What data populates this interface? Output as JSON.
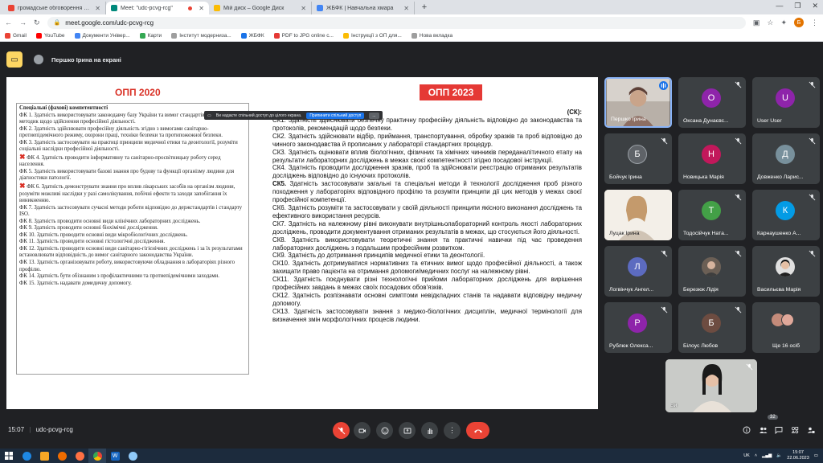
{
  "browser": {
    "tabs": [
      {
        "label": "громадське обговорення ОПП",
        "icon": "gmail-icon",
        "color": "#ea4335",
        "active": false
      },
      {
        "label": "Meet: \"udc-pcvg-rcg\"",
        "icon": "meet-icon",
        "color": "#00897b",
        "active": true
      },
      {
        "label": "Мій диск – Google Диск",
        "icon": "drive-icon",
        "color": "#fbbc04",
        "active": false
      },
      {
        "label": "ЖБФК | Навчальна хмара",
        "icon": "cloud-icon",
        "color": "#4285f4",
        "active": false
      }
    ],
    "url": "meet.google.com/udc-pcvg-rcg",
    "profile_initial": "Б",
    "bookmarks": [
      {
        "label": "Gmail",
        "color": "#ea4335"
      },
      {
        "label": "YouTube",
        "color": "#ff0000"
      },
      {
        "label": "Документи Універ...",
        "color": "#4285f4"
      },
      {
        "label": "Карти",
        "color": "#34a853"
      },
      {
        "label": "Інститут модерниза...",
        "color": "#9e9e9e"
      },
      {
        "label": "ЖБФК",
        "color": "#1a73e8"
      },
      {
        "label": "PDF to JPG online c...",
        "color": "#e53935"
      },
      {
        "label": "Інструкції з ОП для...",
        "color": "#fbbc04"
      },
      {
        "label": "Нова вкладка",
        "color": "#9e9e9e"
      }
    ]
  },
  "meet": {
    "presenter_text": "Першко Ірина на екрані",
    "share_bar": {
      "text": "Ви надаєте спільний доступ до цілого екрана.",
      "stop": "Припинити спільний доступ",
      "dots": "..."
    },
    "slide": {
      "title_left": "ОПП 2020",
      "title_right": "ОПП 2023",
      "left_heading": "Спеціальні (фахові) компетентності",
      "left_items": [
        "ФК 1. Здатність використовувати законодавчу базу України та вимог стандартів, протоколів та методик щодо здійснення професійної діяльності.",
        "ФК 2. Здатність здійснювати професійну діяльність згідно з вимогами санітарно-протиепідемічного режиму, охорони праці, техніки безпеки та протипожежної безпеки.",
        "ФК 3. Здатність застосовувати на практиці принципи медичної етики та деонтології, розуміти соціальні наслідки професійної діяльності.",
        "ФК 4. Здатність проводити інформативну та санітарно-просвітницьку роботу серед населення.",
        "ФК 5. Здатність використовувати базові знання про будову та функції організму людини для діагностики патології.",
        "ФК 6. Здатність демонструвати знання про вплив лікарських засобів на організм людини, розуміти можливі наслідки у разі самолікування, побічні ефекти та заходи запобігання їх виникненню.",
        "ФК 7. Здатність застосовувати сучасні методи роботи відповідно до держстандартів і стандарту ISO.",
        "ФК 8. Здатність проводити основні види клінічних лабораторних досліджень.",
        "ФК 9. Здатність проводити основні біохімічні дослідження.",
        "ФК 10. Здатність проводити основні види мікробіологічних досліджень.",
        "ФК 11. Здатність проводити основні гістологічні дослідження.",
        "ФК 12. Здатність проводити основні види санітарно-гігієнічних досліджень і за їх результатами встановлювати відповідність до вимог санітарного законодавства України.",
        "ФК 13. Здатність організовувати роботу, використовуючи обладнання в лабораторіях різного профілю.",
        "ФК 14. Здатність бути обізнаним з профілактичними та протиепідемічними заходами.",
        "ФК 15. Здатність надавати домедичну допомогу."
      ],
      "right_heading_tail": "(СК):",
      "right_items": [
        {
          "code": "СК1.",
          "text": "Здатність здійснювати безпечну практичну професійну діяльність відповідно до законодавства та протоколів, рекомендацій щодо безпеки."
        },
        {
          "code": "СК2.",
          "text": "Здатність здійснювати відбір, приймання, транспортування, обробку зразків та проб відповідно до чинного законодавства й прописаних у лабораторії стандартних процедур."
        },
        {
          "code": "СК3.",
          "text": "Здатність оцінювати вплив біологічних, фізичних та хімічних чинників переданалітичного етапу на результати лабораторних досліджень в межах своєї компетентності згідно посадової інструкції."
        },
        {
          "code": "СК4.",
          "text": "Здатність проводити дослідження зразків, проб та здійснювати реєстрацію отриманих результатів досліджень відповідно до існуючих протоколів."
        },
        {
          "code": "СК5.",
          "text": "Здатність застосовувати загальні та спеціальні методи й технології дослідження проб різного походження у лабораторіях відповідного профілю та розуміти принципи дії цих методів у межах своєї професійної компетенції.",
          "bold_code": true
        },
        {
          "code": "СК6.",
          "text": "Здатність розуміти та застосовувати у своїй діяльності принципи якісного виконання досліджень та ефективного використання ресурсів."
        },
        {
          "code": "СК7.",
          "text": "Здатність на належному рівні виконувати внутрішньолабораторний контроль якості лабораторних досліджень, проводити документування отриманих результатів в межах, що стосуються його діяльності."
        },
        {
          "code": "СК8.",
          "text": "Здатність використовувати теоретичні знання та практичні навички під час проведення лабораторних досліджень з подальшим професійним розвитком."
        },
        {
          "code": "СК9.",
          "text": "Здатність до дотримання принципів медичної етики та деонтології."
        },
        {
          "code": "СК10.",
          "text": "Здатність дотримуватися нормативних та етичних вимог щодо професійної діяльності, а також захищати право пацієнта на отримання допомоги/медичних послуг на належному рівні."
        },
        {
          "code": "СК11.",
          "text": "Здатність поєднувати різні технологічні прийоми лабораторних досліджень для вирішення професійних завдань в межах своїх посадових обов'язків."
        },
        {
          "code": "СК12.",
          "text": "Здатність розпізнавати основні симптоми невідкладних станів та надавати відповідну медичну допомогу."
        },
        {
          "code": "СК13.",
          "text": "Здатність застосовувати знання з медико-біологічних дисциплін, медичної термінології для визначення змін морфологічних процесів людини."
        }
      ]
    },
    "participants": [
      {
        "name": "Першко Ірина",
        "initial": "",
        "color": "#8d6e63",
        "video": true
      },
      {
        "name": "Оксана Дунаєвс...",
        "initial": "О",
        "color": "#8e24aa"
      },
      {
        "name": "User User",
        "initial": "U",
        "color": "#8e24aa"
      },
      {
        "name": "Бойчук Ірина",
        "initial": "Б",
        "color": "#5f6368"
      },
      {
        "name": "Новицька Марія",
        "initial": "Н",
        "color": "#c2185b"
      },
      {
        "name": "Довженко Ларис...",
        "initial": "Д",
        "color": "#78909c"
      },
      {
        "name": "Луцак Ірина",
        "initial": "",
        "color": "#a1887f",
        "video": true
      },
      {
        "name": "Тодосійчук Ната...",
        "initial": "Т",
        "color": "#43a047"
      },
      {
        "name": "Карнаушенко А...",
        "initial": "К",
        "color": "#039be5"
      },
      {
        "name": "Логвінчук Ангел...",
        "initial": "Л",
        "color": "#5c6bc0"
      },
      {
        "name": "Березюк Лідія",
        "initial": "",
        "color": "#5f6368",
        "photo": true
      },
      {
        "name": "Васильєва Марія",
        "initial": "",
        "color": "#212121",
        "photo": true
      },
      {
        "name": "Рублюк Олекса...",
        "initial": "Р",
        "color": "#8e24aa"
      },
      {
        "name": "Білоус Любов",
        "initial": "Б",
        "color": "#6d4c41"
      },
      {
        "name": "Ще 16 осіб",
        "initial": "",
        "color": "#5f6368",
        "group": true
      }
    ],
    "self_label": "Ви",
    "time": "15:07",
    "meeting_code": "udc-pcvg-rcg",
    "participant_count": "32"
  },
  "taskbar": {
    "lang": "UK",
    "clock_time": "15:07",
    "clock_date": "22.06.2023"
  }
}
